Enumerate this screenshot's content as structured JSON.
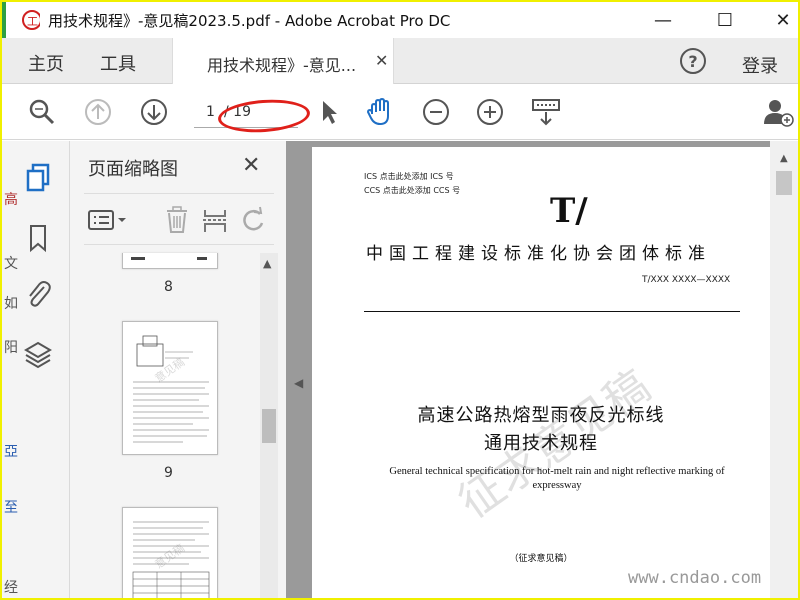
{
  "window": {
    "title": "用技术规程》-意见稿2023.5.pdf - Adobe Acrobat Pro DC",
    "minimize": "—",
    "maximize": "☐",
    "close": "✕"
  },
  "logo_text": "工",
  "tabs": {
    "home": "主页",
    "tools": "工具",
    "document": "用技术规程》-意见...",
    "document_close": "✕"
  },
  "header": {
    "help": "?",
    "login": "登录"
  },
  "toolbar": {
    "page_current": "1",
    "page_total": "/ 19"
  },
  "thumbnails": {
    "title": "页面缩略图",
    "close": "✕",
    "pages": [
      {
        "number": "8"
      },
      {
        "number": "9"
      }
    ],
    "thumb_watermark": "意见稿"
  },
  "left_edge_chars": [
    "高",
    "文",
    "如",
    "阳",
    "亞",
    "至",
    "经"
  ],
  "document_page": {
    "ics": "ICS  点击此处添加 ICS 号",
    "ccs": "CCS  点击此处添加 CCS 号",
    "standard_mark": "T/",
    "organization": "中国工程建设标准化协会团体标准",
    "code": "T/XXX XXXX—XXXX",
    "title_line1": "高速公路热熔型雨夜反光标线",
    "title_line2": "通用技术规程",
    "english_title": "General technical specification for hot-melt rain and night reflective marking of expressway",
    "draft_label": "（征求意见稿）",
    "watermark": "征求意见稿"
  },
  "site_watermark": "www.cndao.com",
  "colors": {
    "outer_frame": "#f0f000",
    "annotation_red": "#e0201a",
    "hand_tool_blue": "#1f6fc5",
    "doc_background": "#9a9a9a"
  }
}
